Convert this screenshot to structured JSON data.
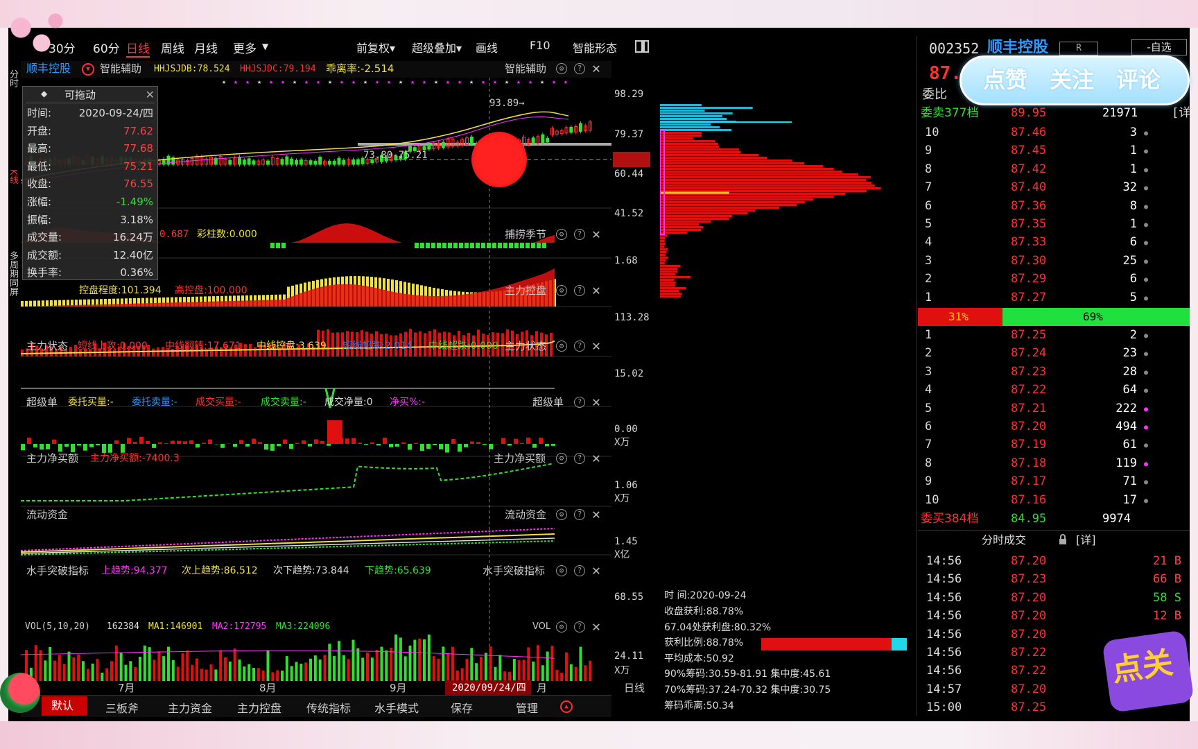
{
  "header": {
    "tabs": [
      "30分",
      "60分",
      "日线",
      "周线",
      "月线",
      "更多"
    ],
    "active_tab": "日线",
    "tools": [
      "前复权",
      "超级叠加",
      "画线",
      "F10",
      "智能形态"
    ]
  },
  "stock": {
    "code": "002352",
    "name": "顺丰控股",
    "badge": "R",
    "watch": "-自选",
    "price": "87.2"
  },
  "chart_header": {
    "stock": "顺丰控股",
    "assist": "智能辅助",
    "v1": "HHJSJDB:78.524",
    "v2": "HHJSJDC:79.194",
    "v3": "乖离率:-2.514",
    "right": "智能辅助"
  },
  "price_axis": [
    "98.29",
    "79.37",
    "67.04",
    "60.44",
    "41.52"
  ],
  "annotations": {
    "high": "93.89→",
    "range": "73.80-75.21"
  },
  "info": {
    "title": "可拖动",
    "rows": [
      {
        "k": "时间:",
        "v": "2020-09-24/四",
        "c": "#dddddd"
      },
      {
        "k": "开盘:",
        "v": "77.62",
        "c": "#ff4040"
      },
      {
        "k": "最高:",
        "v": "77.68",
        "c": "#ff4040"
      },
      {
        "k": "最低:",
        "v": "75.21",
        "c": "#ff4040"
      },
      {
        "k": "收盘:",
        "v": "76.55",
        "c": "#ff4040"
      },
      {
        "k": "涨幅:",
        "v": "-1.49%",
        "c": "#30e030"
      },
      {
        "k": "振幅:",
        "v": "3.18%",
        "c": "#dddddd"
      },
      {
        "k": "成交量:",
        "v": "16.24万",
        "c": "#dddddd"
      },
      {
        "k": "成交额:",
        "v": "12.40亿",
        "c": "#dddddd"
      },
      {
        "k": "换手率:",
        "v": "0.36%",
        "c": "#dddddd"
      }
    ]
  },
  "panels": {
    "p1": {
      "a": "0.687",
      "b": "彩柱数:0.000",
      "right": "捕捞季节",
      "axis": "1.68"
    },
    "p2": {
      "b": "控盘程度:101.394",
      "c": "高控盘:100.000",
      "right": "主力控盘",
      "axis": "113.28"
    },
    "p3": {
      "title": "主力状态",
      "a": "短线上攻:0.000",
      "b": "中线翻转:17.671",
      "c": "中线控盘:3.639",
      "d": "短线超跌:2.014",
      "e": "中线超跌:0.000",
      "right": "主力状态",
      "axis": "15.02"
    },
    "p4": {
      "title": "超级单",
      "a": "委托买量:-",
      "b": "委托卖量:-",
      "c": "成交买量:-",
      "d": "成交卖量:-",
      "e": "成交净量:0",
      "f": "净买%:-",
      "right": "超级单",
      "axis1": "0.00",
      "axis2": "X万"
    },
    "p5": {
      "title": "主力净买额",
      "a": "主力净买额:-7400.3",
      "right": "主力净买额",
      "axis1": "1.06",
      "axis2": "X万"
    },
    "p6": {
      "title": "流动资金",
      "right": "流动资金",
      "axis1": "1.45",
      "axis2": "X亿"
    },
    "p7": {
      "title": "水手突破指标",
      "a": "上趋势:94.377",
      "b": "次上趋势:86.512",
      "c": "次下趋势:73.844",
      "d": "下趋势:65.639",
      "right": "水手突破指标",
      "axis": "68.55"
    },
    "p8": {
      "title": "VOL(5,10,20)",
      "a": "162384",
      "b": "MA1:146901",
      "c": "MA2:172795",
      "d": "MA3:224096",
      "right": "VOL",
      "axis1": "24.11",
      "axis2": "X万"
    }
  },
  "x_axis": {
    "labels": [
      "7月",
      "8月",
      "9月",
      "月"
    ],
    "date": "2020/09/24/四",
    "period": "日线"
  },
  "bottom_tabs": [
    "默认",
    "三板斧",
    "主力资金",
    "主力控盘",
    "传统指标",
    "水手模式",
    "保存",
    "管理"
  ],
  "side_labels": {
    "s1": "分时",
    "s2": "K线",
    "s3": "多周期同屏"
  },
  "chip": {
    "time_label": "时 间:2020-09-24",
    "rows": [
      "收盘获利:88.78%",
      "67.04处获利盘:80.32%",
      "获利比例:88.78%",
      "平均成本:50.92",
      "90%筹码:30.59-81.91 集中度:45.61",
      "70%筹码:37.24-70.32 集中度:30.75",
      "筹码乖离:50.34"
    ]
  },
  "orderbook": {
    "weibi": "委比",
    "sell_header": {
      "label": "委卖377档",
      "price": "89.95",
      "vol": "21971",
      "detail": "[详"
    },
    "sells": [
      {
        "l": "10",
        "p": "87.46",
        "v": "3"
      },
      {
        "l": "9",
        "p": "87.45",
        "v": "1"
      },
      {
        "l": "8",
        "p": "87.42",
        "v": "1"
      },
      {
        "l": "7",
        "p": "87.40",
        "v": "32"
      },
      {
        "l": "6",
        "p": "87.36",
        "v": "8"
      },
      {
        "l": "5",
        "p": "87.35",
        "v": "1"
      },
      {
        "l": "4",
        "p": "87.33",
        "v": "6"
      },
      {
        "l": "3",
        "p": "87.30",
        "v": "25"
      },
      {
        "l": "2",
        "p": "87.29",
        "v": "6"
      },
      {
        "l": "1",
        "p": "87.27",
        "v": "5"
      }
    ],
    "ratio": {
      "sell_pct": "31%",
      "buy_pct": "69%",
      "sell": 0.31
    },
    "buys": [
      {
        "l": "1",
        "p": "87.25",
        "v": "2"
      },
      {
        "l": "2",
        "p": "87.24",
        "v": "23"
      },
      {
        "l": "3",
        "p": "87.23",
        "v": "28"
      },
      {
        "l": "4",
        "p": "87.22",
        "v": "64"
      },
      {
        "l": "5",
        "p": "87.21",
        "v": "222"
      },
      {
        "l": "6",
        "p": "87.20",
        "v": "494"
      },
      {
        "l": "7",
        "p": "87.19",
        "v": "61"
      },
      {
        "l": "8",
        "p": "87.18",
        "v": "119"
      },
      {
        "l": "9",
        "p": "87.17",
        "v": "71"
      },
      {
        "l": "10",
        "p": "87.16",
        "v": "17"
      }
    ],
    "buy_header": {
      "label": "委买384档",
      "price": "84.95",
      "vol": "9974"
    }
  },
  "ticks": {
    "title": "分时成交",
    "detail": "[详]",
    "rows": [
      {
        "t": "14:56",
        "p": "87.20",
        "v": "21 B",
        "c": "#ff4040"
      },
      {
        "t": "14:56",
        "p": "87.23",
        "v": "66 B",
        "c": "#ff4040"
      },
      {
        "t": "14:56",
        "p": "87.20",
        "v": "58 S",
        "c": "#30e030"
      },
      {
        "t": "14:56",
        "p": "87.20",
        "v": "12 B",
        "c": "#ff4040"
      },
      {
        "t": "14:56",
        "p": "87.20",
        "v": "",
        "c": "#ff4040"
      },
      {
        "t": "14:56",
        "p": "87.22",
        "v": "",
        "c": "#ff4040"
      },
      {
        "t": "14:56",
        "p": "87.22",
        "v": "",
        "c": "#ff4040"
      },
      {
        "t": "14:57",
        "p": "87.20",
        "v": "",
        "c": "#ff4040"
      },
      {
        "t": "15:00",
        "p": "87.25",
        "v": "",
        "c": "#ff4040"
      }
    ]
  },
  "overlay": {
    "a": "点赞",
    "b": "关注",
    "c": "评论",
    "sticker": "点关"
  }
}
